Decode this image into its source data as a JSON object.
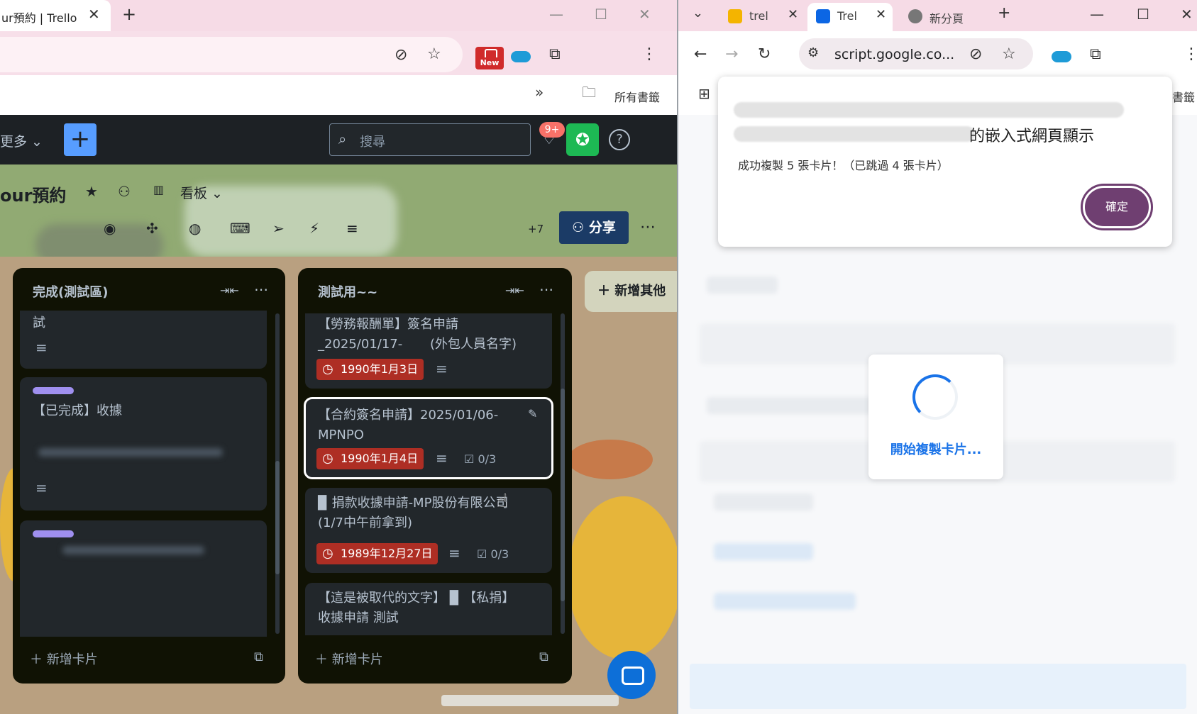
{
  "left_window": {
    "tab_title": "ur預約 | Trello",
    "bookmarks_label": "所有書籤",
    "new_badge": "New",
    "trello_header": {
      "more_label": "更多",
      "search_placeholder": "搜尋",
      "notification_count": "9+"
    },
    "board": {
      "name": "our預約",
      "view_label": "看板",
      "member_overflow": "+7",
      "share_label": "分享"
    },
    "lists": [
      {
        "title": "完成(測試區)",
        "cards": [
          {
            "text": "試"
          },
          {
            "text": "【已完成】收據"
          },
          {
            "text": ""
          }
        ],
        "add_card_label": "新增卡片"
      },
      {
        "title": "測試用~~",
        "cards": [
          {
            "line1": "【勞務報酬單】簽名申請",
            "line2": "_2025/01/17-",
            "line2b": "(外包人員名字)",
            "due": "1990年1月3日"
          },
          {
            "line1": "【合約簽名申請】2025/01/06-",
            "line2": "MPNPO",
            "due": "1990年1月4日",
            "checklist": "0/3"
          },
          {
            "line1": "▉ 捐款收據申請-MP股份有限公司",
            "line2": "(1/7中午前拿到)",
            "due": "1989年12月27日",
            "checklist": "0/3"
          },
          {
            "line1": "【這是被取代的文字】 ▉ 【私捐】",
            "line2": "收據申請 測試"
          }
        ],
        "add_card_label": "新增卡片"
      }
    ],
    "add_list_label": "新增其他"
  },
  "right_window": {
    "tabs": [
      {
        "title": "trel"
      },
      {
        "title": "Trel"
      },
      {
        "title": "新分頁"
      }
    ],
    "url": "script.google.co...",
    "bookmarks_tail": "書籤",
    "dialog": {
      "title_tail": "的嵌入式網頁顯示",
      "message": "成功複製 5 張卡片！（已跳過 4 張卡片）",
      "ok_label": "確定"
    },
    "loading": {
      "text": "開始複製卡片..."
    }
  },
  "colors": {
    "trello_header": "#1d2125",
    "list_bg": "#101204",
    "card_bg": "#22272b",
    "due_red": "#ae2e24",
    "share_blue": "#1b3b66",
    "dialog_ok": "#6f3f71",
    "loading_blue": "#1a73e8"
  }
}
